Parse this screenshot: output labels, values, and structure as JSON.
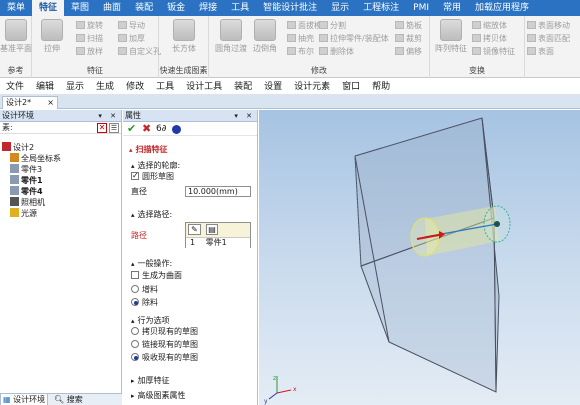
{
  "ribbon": {
    "tabs": [
      "菜单",
      "特征",
      "草图",
      "曲面",
      "装配",
      "钣金",
      "焊接",
      "工具",
      "智能设计批注",
      "显示",
      "工程标注",
      "PMI",
      "常用",
      "加载应用程序"
    ],
    "active_tab": "特征",
    "groups": {
      "reference": {
        "label": "参考",
        "big": "基准平面"
      },
      "feature": {
        "label": "特征",
        "big": "拉伸",
        "small": [
          "旋转",
          "扫描",
          "放样",
          "导动",
          "加厚",
          "自定义孔"
        ]
      },
      "quickgen": {
        "label": "快速生成图素",
        "big": "长方体"
      },
      "modify": {
        "label": "修改",
        "big": [
          "圆角过渡",
          "边倒角"
        ],
        "small": [
          "面拔模",
          "抽壳",
          "布尔",
          "分割",
          "拉伸零件/装配体",
          "删除体",
          "筋板",
          "裁剪",
          "偏移"
        ]
      },
      "transform": {
        "label": "变换",
        "big": "阵列特征",
        "small": [
          "缩放体",
          "拷贝体",
          "镜像特征"
        ]
      },
      "edit": {
        "small": [
          "表面移动",
          "表面匹配",
          "表面"
        ]
      }
    }
  },
  "menubar": {
    "items": [
      "文件",
      "编辑",
      "显示",
      "生成",
      "修改",
      "工具",
      "设计工具",
      "装配",
      "设置",
      "设计元素",
      "窗口",
      "帮助"
    ]
  },
  "doc_tab": {
    "label": "设计2*",
    "close": "×"
  },
  "left_panel": {
    "title": "设计环境",
    "search_label": "素:",
    "tree": [
      "设计2",
      "全局坐标系",
      "零件3",
      "零件1",
      "零件4",
      "照相机",
      "光源"
    ],
    "bottom_tabs": [
      "设计环境",
      "搜索"
    ]
  },
  "property_panel": {
    "title": "属性",
    "feature_title": "扫描特征",
    "profile_section": "选择的轮廓:",
    "circle_sketch": "圆形草图",
    "diameter_label": "直径",
    "diameter_value": "10.000(mm)",
    "path_section": "选择路径:",
    "path_label": "路径",
    "path_row_num": "1",
    "path_row_item": "零件1",
    "general_section": "一般操作:",
    "gen_surface": "生成为曲面",
    "add_material": "增料",
    "remove_material": "除料",
    "behavior_section": "行为选项",
    "copy_sketch": "拷贝现有的草图",
    "link_sketch": "链接现有的草图",
    "absorb_sketch": "吸收现有的草图",
    "thicken_section": "加厚特征",
    "advanced_section": "高级图素属性"
  },
  "colors": {
    "ribbon_blue": "#2b73c2",
    "panel_header": "#d7e3f3",
    "feature_title_red": "#c0282d",
    "viewport_top": "#a6c3e2"
  }
}
